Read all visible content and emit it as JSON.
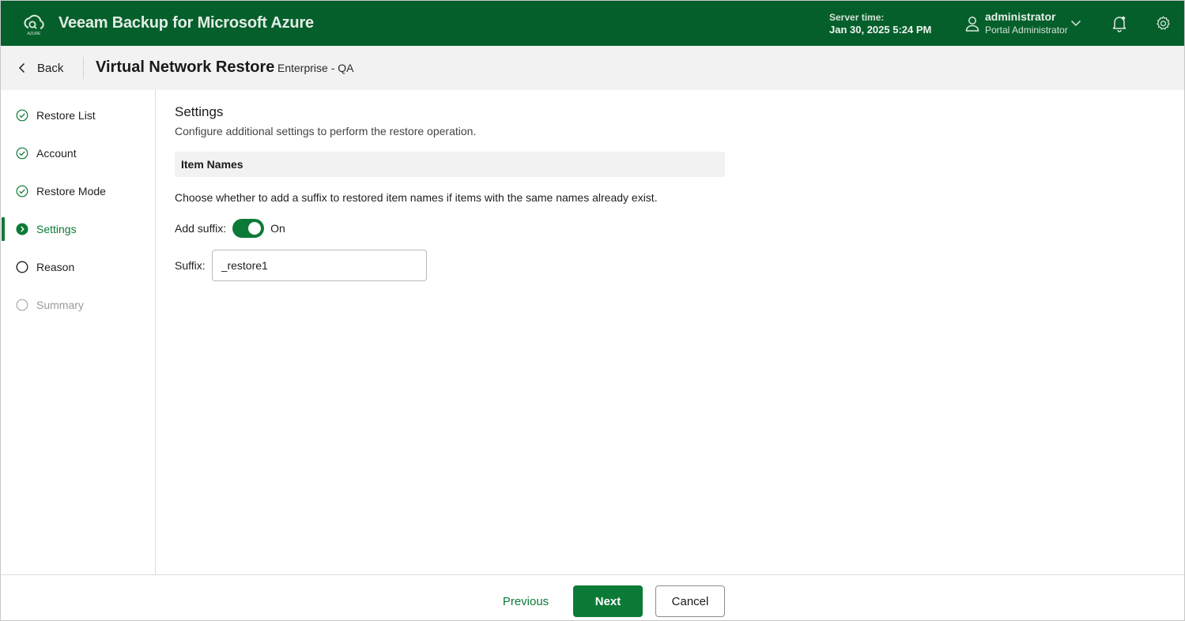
{
  "header": {
    "app_title": "Veeam Backup for Microsoft Azure",
    "logo_text": "AZURE",
    "server_time_label": "Server time:",
    "server_time_value": "Jan 30, 2025 5:24 PM",
    "user_name": "administrator",
    "user_role": "Portal Administrator",
    "icons": [
      "veeam-azure-logo-icon",
      "user-icon",
      "chevron-down-icon",
      "bell-icon",
      "gear-icon"
    ]
  },
  "subheader": {
    "back_label": "Back",
    "title": "Virtual Network Restore",
    "subtitle": "Enterprise - QA"
  },
  "steps": [
    {
      "label": "Restore List",
      "status": "completed"
    },
    {
      "label": "Account",
      "status": "completed"
    },
    {
      "label": "Restore Mode",
      "status": "completed"
    },
    {
      "label": "Settings",
      "status": "active"
    },
    {
      "label": "Reason",
      "status": "pending"
    },
    {
      "label": "Summary",
      "status": "disabled"
    }
  ],
  "main": {
    "title": "Settings",
    "description": "Configure additional settings to perform the restore operation.",
    "group_title": "Item Names",
    "help_text": "Choose whether to add a suffix to restored item names if items with the same names already exist.",
    "add_suffix_label": "Add suffix:",
    "add_suffix_state": "On",
    "suffix_label": "Suffix:",
    "suffix_value": "_restore1"
  },
  "footer": {
    "previous_label": "Previous",
    "next_label": "Next",
    "cancel_label": "Cancel"
  },
  "colors": {
    "brand_green": "#055f2b",
    "accent_green": "#0b7a36",
    "subheader_bg": "#f1f2f1"
  }
}
